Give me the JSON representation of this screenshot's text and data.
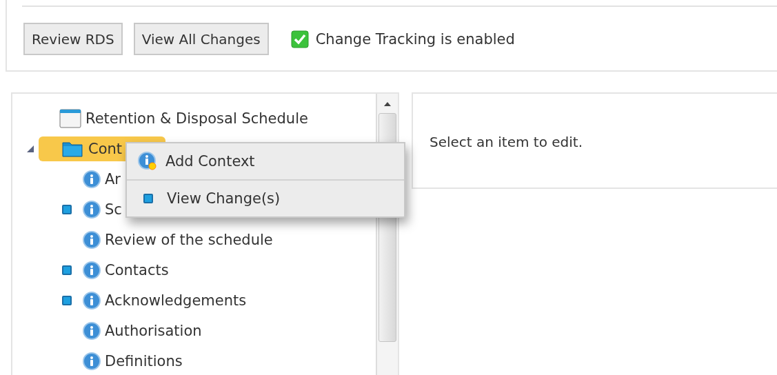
{
  "toolbar": {
    "buttons": [
      "Review RDS",
      "View All Changes"
    ],
    "tracking": {
      "checked": true,
      "label": "Change Tracking is enabled"
    }
  },
  "tree": {
    "root": {
      "label": "Retention & Disposal Schedule",
      "children": [
        {
          "label": "Cont",
          "kind": "folder",
          "selected": true,
          "expanded": true,
          "children": [
            {
              "label": "Ar",
              "kind": "info",
              "selected": false,
              "changed": false
            },
            {
              "label": "Sc",
              "kind": "info",
              "selected": false,
              "changed": true
            },
            {
              "label": "Review of the schedule",
              "kind": "info",
              "selected": false,
              "changed": false
            },
            {
              "label": "Contacts",
              "kind": "info",
              "selected": false,
              "changed": true
            },
            {
              "label": "Acknowledgements",
              "kind": "info",
              "selected": false,
              "changed": true
            },
            {
              "label": "Authorisation",
              "kind": "info",
              "selected": false,
              "changed": false
            },
            {
              "label": "Definitions",
              "kind": "info",
              "selected": false,
              "changed": false
            }
          ]
        }
      ]
    }
  },
  "context_menu": {
    "items": [
      {
        "label": "Add Context",
        "kind": "add"
      },
      {
        "label": "View Change(s)",
        "kind": "changes"
      }
    ]
  },
  "editor": {
    "message": "Select an item to edit."
  }
}
